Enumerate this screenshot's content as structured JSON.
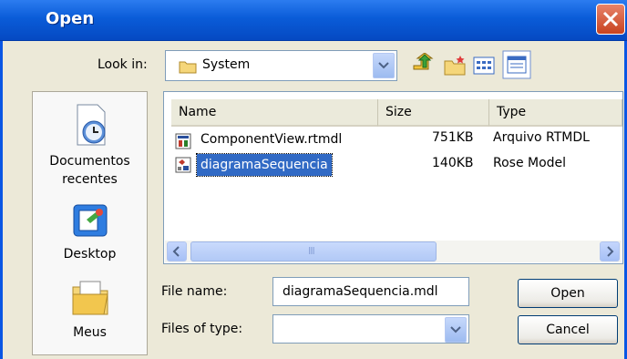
{
  "window": {
    "title": "Open"
  },
  "lookin": {
    "label": "Look in:",
    "value": "System"
  },
  "places": [
    {
      "label": "Documentos recentes",
      "icon": "recent-documents-icon"
    },
    {
      "label": "Desktop",
      "icon": "desktop-icon"
    },
    {
      "label": "Meus",
      "icon": "my-documents-icon"
    }
  ],
  "columns": {
    "name": "Name",
    "size": "Size",
    "type": "Type"
  },
  "files": [
    {
      "name": "ComponentView.rtmdl",
      "size": "751KB",
      "type": "Arquivo RTMDL",
      "icon": "rtmdl-file-icon",
      "selected": false
    },
    {
      "name": "diagramaSequencia",
      "size": "140KB",
      "type": "Rose Model",
      "icon": "rose-model-file-icon",
      "selected": true
    }
  ],
  "scroll": {
    "grip": "III"
  },
  "filename": {
    "label": "File name:",
    "value": "diagramaSequencia.mdl"
  },
  "filetype": {
    "label": "Files of type:",
    "value": ""
  },
  "buttons": {
    "open": "Open",
    "cancel": "Cancel"
  },
  "colors": {
    "titlebar": "#0a5cd8",
    "selection": "#316ac5",
    "dialog_bg": "#ece9d8"
  }
}
